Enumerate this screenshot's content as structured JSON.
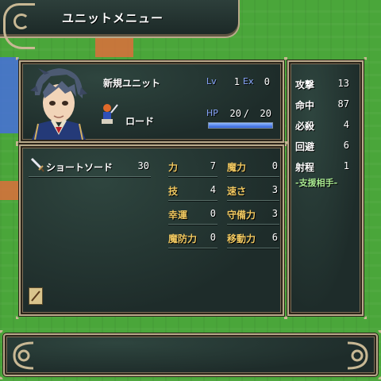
{
  "menu": {
    "title": "ユニットメニュー"
  },
  "unit": {
    "name": "新規ユニット",
    "class": "ロード",
    "lv_label": "Lv",
    "lv": "1",
    "ex_label": "Ex",
    "ex": "0",
    "hp_label": "HP",
    "hp_current": "20",
    "hp_sep": "/",
    "hp_max": "20",
    "hp_fraction": 1.0
  },
  "weapon": {
    "name": "ショートソード",
    "uses": "30",
    "icon": "sword-icon"
  },
  "stats": [
    {
      "label": "力",
      "value": "7"
    },
    {
      "label": "技",
      "value": "4"
    },
    {
      "label": "幸運",
      "value": "0"
    },
    {
      "label": "魔防力",
      "value": "0"
    }
  ],
  "stats2": [
    {
      "label": "魔力",
      "value": "0"
    },
    {
      "label": "速さ",
      "value": "3"
    },
    {
      "label": "守備力",
      "value": "3"
    },
    {
      "label": "移動力",
      "value": "6"
    }
  ],
  "combat": [
    {
      "label": "攻撃",
      "value": "13"
    },
    {
      "label": "命中",
      "value": "87"
    },
    {
      "label": "必殺",
      "value": "4"
    },
    {
      "label": "回避",
      "value": "6"
    },
    {
      "label": "射程",
      "value": "1"
    }
  ],
  "support": {
    "label": "-支援相手-"
  },
  "colors": {
    "gold": "#f0c860",
    "panel": "#1e2c2a",
    "border": "#b8a98a",
    "hp_bar": "#2f5fd8"
  }
}
